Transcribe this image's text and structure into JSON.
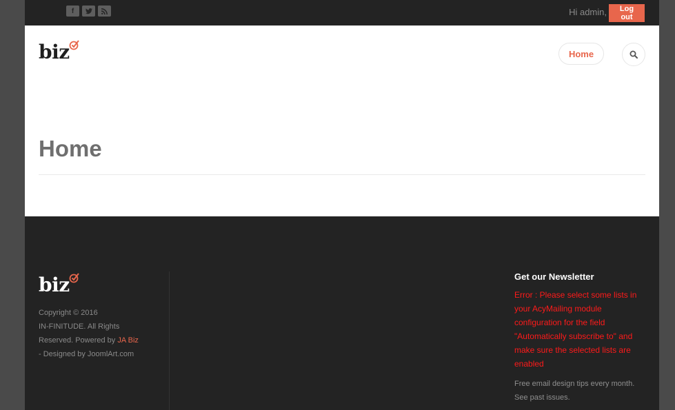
{
  "topbar": {
    "social": [
      {
        "icon": "facebook-icon",
        "glyph": "f"
      },
      {
        "icon": "twitter-icon",
        "glyph": "t"
      },
      {
        "icon": "rss-icon",
        "glyph": ")"
      }
    ],
    "greeting": "Hi admin,",
    "logout_label": "Log out"
  },
  "header": {
    "logo_text": "biz",
    "nav": [
      {
        "label": "Home"
      }
    ],
    "search_icon": "search-icon"
  },
  "main": {
    "title": "Home"
  },
  "footer": {
    "logo_text": "biz",
    "copyright_line1": "Copyright © 2016",
    "copyright_line2": "IN-FINITUDE. All Rights",
    "copyright_line3": "Reserved. Powered by ",
    "copyright_link": "JA Biz",
    "copyright_line4": "- Designed by JoomlArt.com",
    "newsletter": {
      "title": "Get our Newsletter",
      "error": "Error : Please select some lists in your AcyMailing module configuration for the field \"Automatically subscribe to\" and make sure the selected lists are enabled",
      "description": "Free email design tips every month. See past issues."
    }
  },
  "colors": {
    "accent": "#e8664c",
    "error": "#ff1a1a",
    "dark": "#232323"
  }
}
